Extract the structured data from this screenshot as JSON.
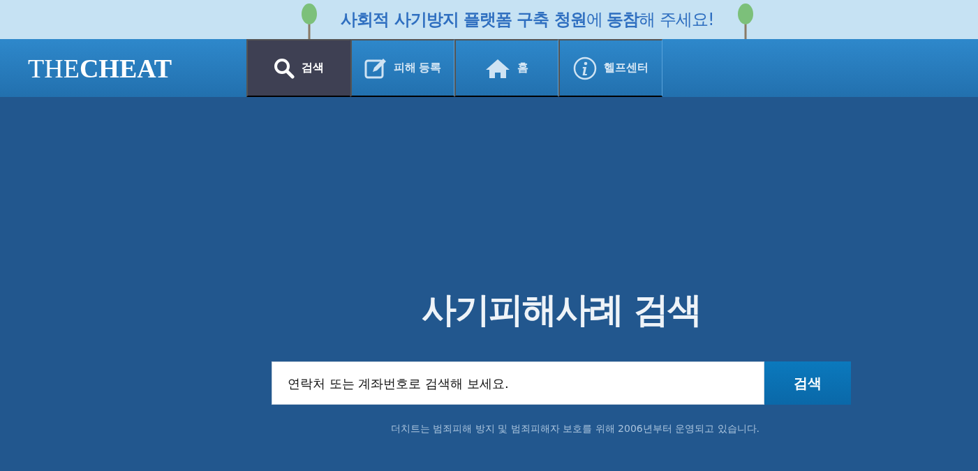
{
  "banner": {
    "text": "**사회적 사기방지 플랫폼 구축 청원**에 **동참**해 주세요!"
  },
  "header": {
    "logo": "THE**CHEAT**",
    "nav": [
      {
        "kind": "search",
        "label": "검색",
        "selected": true
      },
      {
        "kind": "edit",
        "label": "피해 등록",
        "selected": false
      },
      {
        "kind": "home",
        "label": "홈",
        "selected": false
      },
      {
        "kind": "info",
        "label": "헬프센터",
        "selected": false
      }
    ]
  },
  "main": {
    "heading": "사기피해사례 검색",
    "search": {
      "placeholder": "연락처 또는 계좌번호로 검색해 보세요.",
      "button": "검색"
    },
    "note": "더치트는 범죄피해 방지 및 범죄피해자 보호를 위해 2006년부터 운영되고 있습니다."
  }
}
